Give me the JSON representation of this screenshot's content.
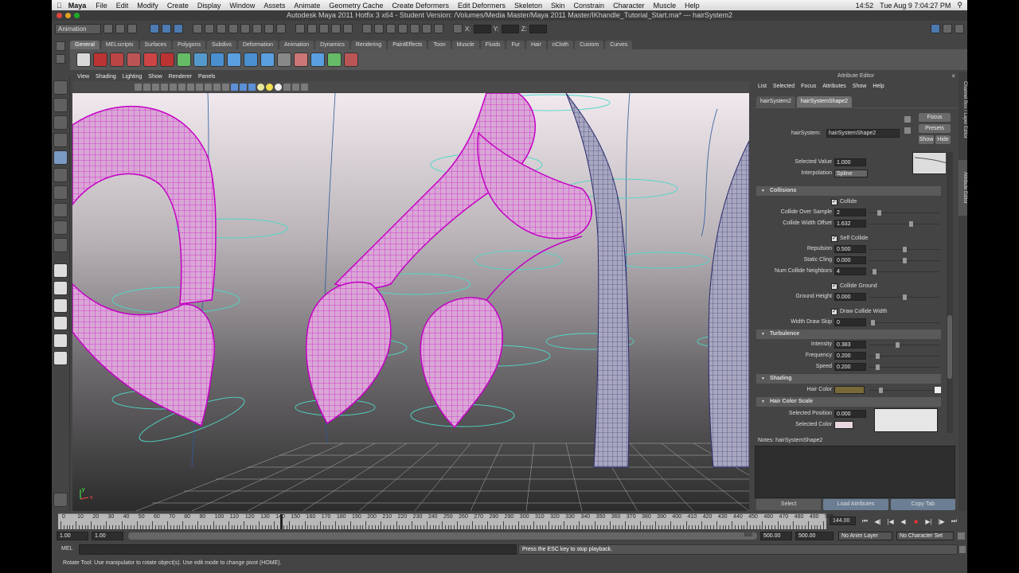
{
  "mac": {
    "app": "Maya",
    "menus": [
      "File",
      "Edit",
      "Modify",
      "Create",
      "Display",
      "Window",
      "Assets",
      "Animate",
      "Geometry Cache",
      "Create Deformers",
      "Edit Deformers",
      "Skeleton",
      "Skin",
      "Constrain",
      "Character",
      "Muscle",
      "Help"
    ],
    "battery": "14:52",
    "clock": "Tue Aug 9  7:04:27 PM"
  },
  "window_title": "Autodesk Maya 2011 Hotfix 3 x64 - Student Version: /Volumes/Media Master/Maya 2011 Master/IKhandle_Tutorial_Start.ma*  ---  hairSystem2",
  "statusline": {
    "menu_set": "Animation",
    "x_label": "X:",
    "y_label": "Y:",
    "z_label": "Z:"
  },
  "shelf": {
    "tabs": [
      "General",
      "MELscripts",
      "Surfaces",
      "Polygons",
      "Subdivs",
      "Deformation",
      "Animation",
      "Dynamics",
      "Rendering",
      "PaintEffects",
      "Toon",
      "Muscle",
      "Fluids",
      "Fur",
      "Hair",
      "nCloth",
      "Custom",
      "Curves"
    ],
    "active_tab": "General"
  },
  "viewport": {
    "menus": [
      "View",
      "Shading",
      "Lighting",
      "Show",
      "Renderer",
      "Panels"
    ],
    "axis_y": "y",
    "axis_x": "x"
  },
  "attribute_editor": {
    "title": "Attribute Editor",
    "menus": [
      "List",
      "Selected",
      "Focus",
      "Attributes",
      "Show",
      "Help"
    ],
    "tabs": [
      "hairSystem2",
      "hairSystemShape2"
    ],
    "active_tab": "hairSystemShape2",
    "node_label": "hairSystem:",
    "node_value": "hairSystemShape2",
    "focus_btn": "Focus",
    "presets_btn": "Presets",
    "show_btn": "Show",
    "hide_btn": "Hide",
    "selected_value_label": "Selected Value",
    "selected_value": "1.000",
    "interpolation_label": "Interpolation",
    "interpolation": "Spline",
    "collisions": {
      "title": "Collisions",
      "collide": "Collide",
      "collide_over_sample_label": "Collide Over Sample",
      "collide_over_sample": "2",
      "collide_width_offset_label": "Collide Width Offset",
      "collide_width_offset": "1.632",
      "self_collide": "Self Collide",
      "repulsion_label": "Repulsion",
      "repulsion": "0.500",
      "static_cling_label": "Static Cling",
      "static_cling": "0.000",
      "num_neighbors_label": "Num Collide Neighbors",
      "num_neighbors": "4",
      "collide_ground": "Collide Ground",
      "ground_height_label": "Ground Height",
      "ground_height": "0.000",
      "draw_collide_width": "Draw Collide Width",
      "width_draw_skip_label": "Width Draw Skip",
      "width_draw_skip": "0"
    },
    "turbulence": {
      "title": "Turbulence",
      "intensity_label": "Intensity",
      "intensity": "0.383",
      "frequency_label": "Frequency",
      "frequency": "0.200",
      "speed_label": "Speed",
      "speed": "0.200"
    },
    "shading": {
      "title": "Shading",
      "hair_color_label": "Hair Color",
      "hair_color": "#7a6a3a"
    },
    "hair_color_scale": {
      "title": "Hair Color Scale",
      "selected_position_label": "Selected Position",
      "selected_position": "0.000",
      "selected_color_label": "Selected Color"
    },
    "notes_label": "Notes:  hairSystemShape2",
    "buttons": [
      "Select",
      "Load Attributes",
      "Copy Tab"
    ]
  },
  "side_tabs": [
    "Channel Box / Layer Editor",
    "Attribute Editor"
  ],
  "time_slider": {
    "ticks": [
      "0",
      "10",
      "20",
      "30",
      "40",
      "50",
      "60",
      "70",
      "80",
      "90",
      "100",
      "110",
      "120",
      "130",
      "140",
      "150",
      "160",
      "170",
      "180",
      "190",
      "200",
      "210",
      "220",
      "230",
      "240",
      "250",
      "260",
      "270",
      "280",
      "290",
      "300",
      "310",
      "320",
      "330",
      "340",
      "350",
      "360",
      "370",
      "380",
      "390",
      "400",
      "410",
      "420",
      "430",
      "440",
      "450",
      "460",
      "470",
      "480",
      "490",
      "500"
    ],
    "current_frame": "144.00",
    "current_frame_fraction": 0.288
  },
  "range_slider": {
    "start": "1.00",
    "start2": "1.00",
    "bar_label": "500",
    "end": "500.00",
    "end2": "500.00",
    "anim_layer": "No Anim Layer",
    "character_set": "No Character Set"
  },
  "command_line": {
    "mode": "MEL",
    "output": "Press the ESC key to stop playback."
  },
  "help_line": "Rotate Tool: Use manipulator to rotate object(s). Use edit mode to change pivot (HOME)."
}
